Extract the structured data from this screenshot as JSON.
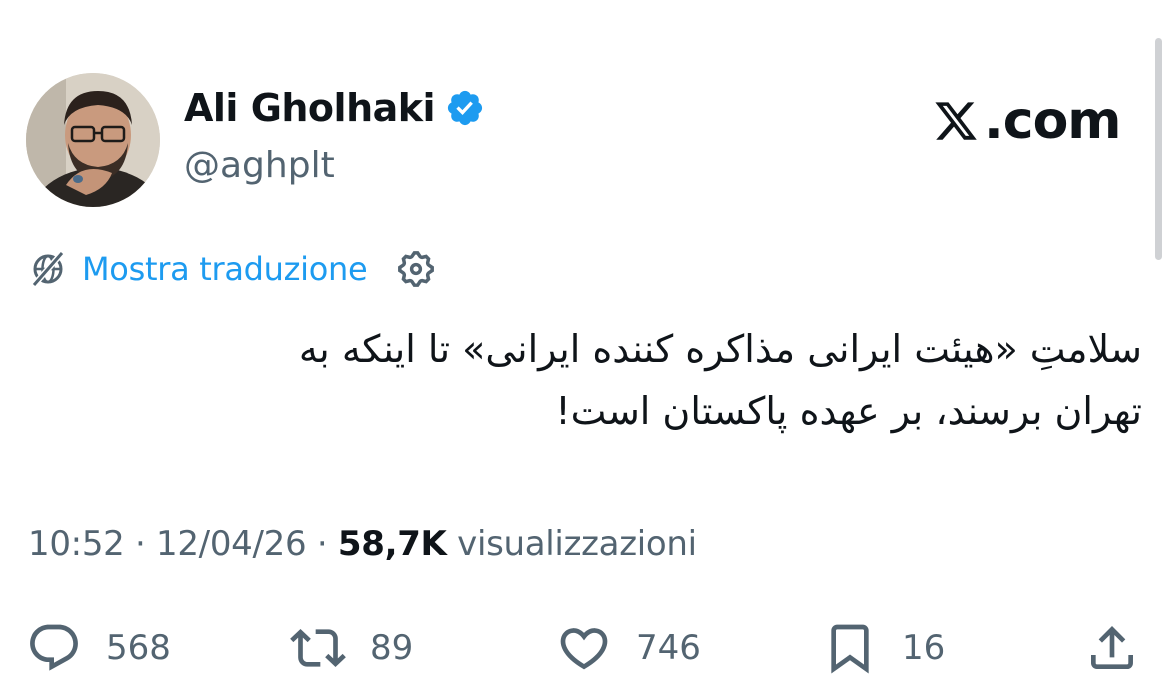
{
  "author": {
    "name": "Ali Gholhaki",
    "handle": "@aghplt",
    "verified": true,
    "avatar_icon": "user-avatar-photo"
  },
  "site_logo": ".com",
  "translation": {
    "link_label": "Mostra traduzione",
    "icon": "globe-slash-icon",
    "settings_icon": "gear-icon"
  },
  "tweet": {
    "lines": [
      "سلامتِ «هیئت ایرانی مذاکره کننده ایرانی» تا اینکه به",
      "تهران برسند، بر عهده پاکستان است!"
    ]
  },
  "meta": {
    "time": "10:52",
    "date": "12/04/26",
    "views_count": "58,7K",
    "views_label": "visualizzazioni"
  },
  "actions": {
    "replies": "568",
    "reposts": "89",
    "likes": "746",
    "bookmarks": "16"
  },
  "colors": {
    "accent": "#1d9bf0",
    "muted": "#536471",
    "text": "#0f1419"
  }
}
